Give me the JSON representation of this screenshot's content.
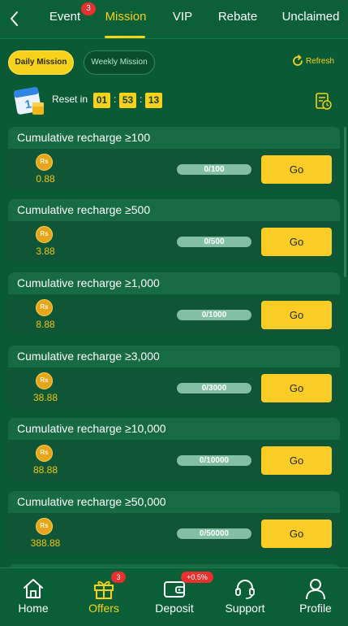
{
  "header": {
    "tabs": [
      {
        "label": "Event"
      },
      {
        "label": "Mission"
      },
      {
        "label": "VIP"
      },
      {
        "label": "Rebate"
      },
      {
        "label": "Unclaimed"
      }
    ],
    "active_tab": "Mission",
    "event_badge": "3"
  },
  "mission_types": {
    "daily": "Daily Mission",
    "weekly": "Weekly Mission",
    "selected": "Daily Mission"
  },
  "refresh_label": "Refresh",
  "reset": {
    "label": "Reset in",
    "hours": "01",
    "minutes": "53",
    "seconds": "13"
  },
  "missions": [
    {
      "title": "Cumulative recharge ≥100",
      "reward": "0.88",
      "progress_text": "0/100",
      "progress": 0,
      "button": "Go"
    },
    {
      "title": "Cumulative recharge ≥500",
      "reward": "3.88",
      "progress_text": "0/500",
      "progress": 0,
      "button": "Go"
    },
    {
      "title": "Cumulative recharge ≥1,000",
      "reward": "8.88",
      "progress_text": "0/1000",
      "progress": 0,
      "button": "Go"
    },
    {
      "title": "Cumulative recharge ≥3,000",
      "reward": "38.88",
      "progress_text": "0/3000",
      "progress": 0,
      "button": "Go"
    },
    {
      "title": "Cumulative recharge ≥10,000",
      "reward": "88.88",
      "progress_text": "0/10000",
      "progress": 0,
      "button": "Go"
    },
    {
      "title": "Cumulative recharge ≥50,000",
      "reward": "388.88",
      "progress_text": "0/50000",
      "progress": 0,
      "button": "Go"
    }
  ],
  "coin_symbol": "Rs",
  "bottom_nav": {
    "items": [
      {
        "label": "Home",
        "icon": "home-icon"
      },
      {
        "label": "Offers",
        "icon": "gift-icon",
        "badge": "3"
      },
      {
        "label": "Deposit",
        "icon": "wallet-icon",
        "badge": "+0.5%"
      },
      {
        "label": "Support",
        "icon": "headset-icon"
      },
      {
        "label": "Profile",
        "icon": "user-icon"
      }
    ],
    "active": "Offers"
  },
  "colors": {
    "background": "#0b5a36",
    "accent": "#f6d21a",
    "badge": "#e8312f"
  }
}
